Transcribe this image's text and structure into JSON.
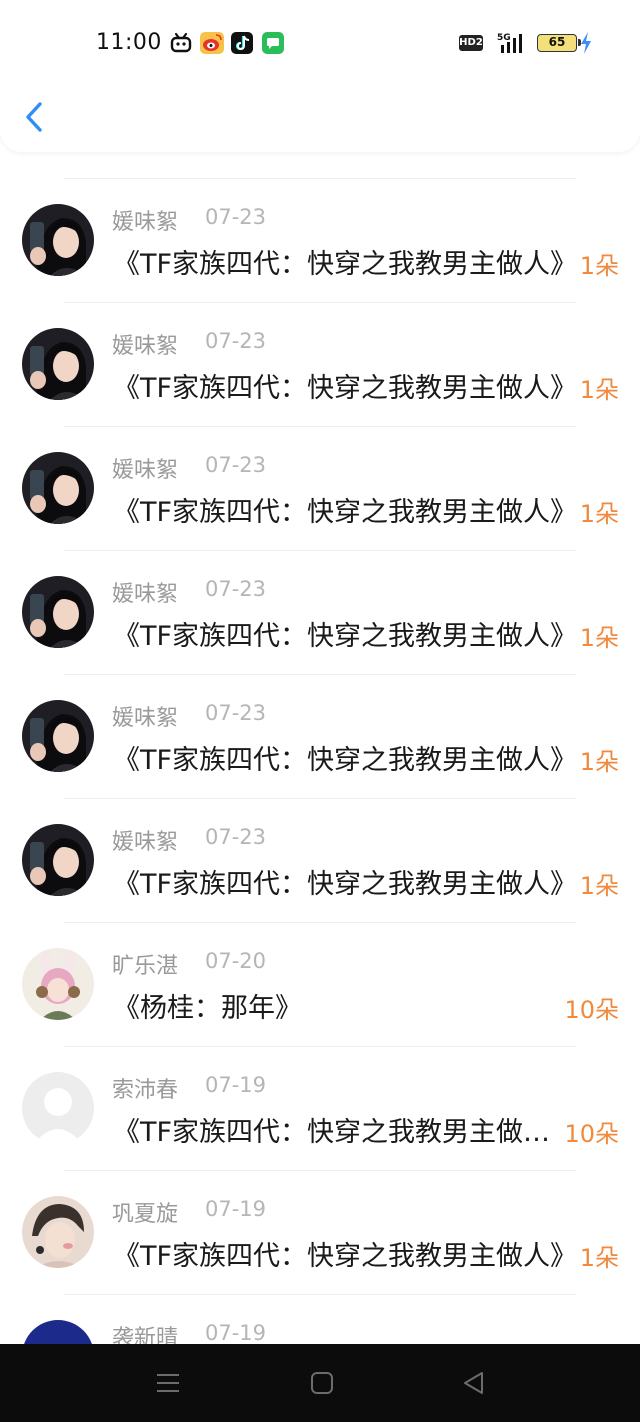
{
  "status_bar": {
    "time": "11:00",
    "hd_label": "HD2",
    "network": "5G",
    "battery": "65"
  },
  "header": {
    "back_icon": "chevron-left-icon"
  },
  "rows": [
    {
      "name": "媛味絮",
      "date": "07-23",
      "title": "《TF家族四代：快穿之我教男主做人》",
      "count": "1朵",
      "avatar": "girl-selfie"
    },
    {
      "name": "媛味絮",
      "date": "07-23",
      "title": "《TF家族四代：快穿之我教男主做人》",
      "count": "1朵",
      "avatar": "girl-selfie"
    },
    {
      "name": "媛味絮",
      "date": "07-23",
      "title": "《TF家族四代：快穿之我教男主做人》",
      "count": "1朵",
      "avatar": "girl-selfie"
    },
    {
      "name": "媛味絮",
      "date": "07-23",
      "title": "《TF家族四代：快穿之我教男主做人》",
      "count": "1朵",
      "avatar": "girl-selfie"
    },
    {
      "name": "媛味絮",
      "date": "07-23",
      "title": "《TF家族四代：快穿之我教男主做人》",
      "count": "1朵",
      "avatar": "girl-selfie"
    },
    {
      "name": "媛味絮",
      "date": "07-23",
      "title": "《TF家族四代：快穿之我教男主做人》",
      "count": "1朵",
      "avatar": "girl-selfie"
    },
    {
      "name": "旷乐湛",
      "date": "07-20",
      "title": "《杨桂：那年》",
      "count": "10朵",
      "avatar": "anime-bunny"
    },
    {
      "name": "索沛春",
      "date": "07-19",
      "title": "《TF家族四代：快穿之我教男主做人》",
      "count": "10朵",
      "avatar": "default"
    },
    {
      "name": "巩夏旋",
      "date": "07-19",
      "title": "《TF家族四代：快穿之我教男主做人》",
      "count": "1朵",
      "avatar": "anime-boy"
    },
    {
      "name": "袭新晴",
      "date": "07-19",
      "title": "",
      "count": "",
      "avatar": "blue"
    }
  ],
  "colors": {
    "accent_back": "#2f8ef5",
    "count": "#ef8a3f",
    "navbar": "#0c0c0c"
  },
  "navbar": {
    "menu_icon": "menu-icon",
    "home_icon": "home-square-icon",
    "back_icon": "back-triangle-icon"
  }
}
